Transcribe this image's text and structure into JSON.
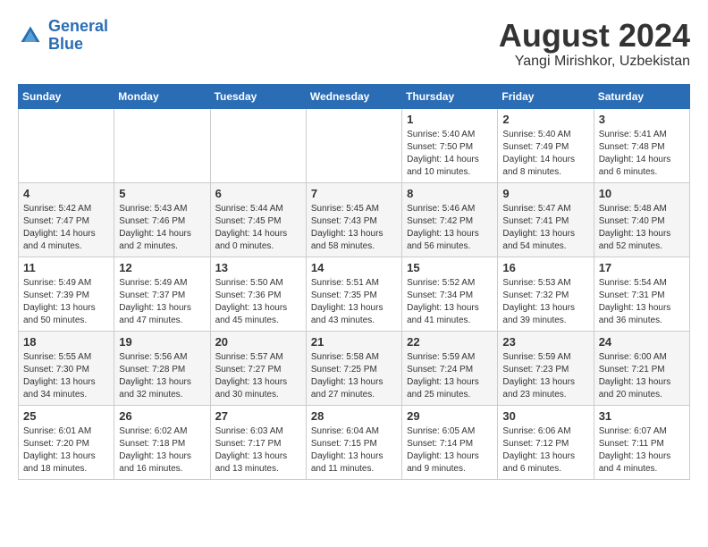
{
  "header": {
    "logo_line1": "General",
    "logo_line2": "Blue",
    "month_year": "August 2024",
    "location": "Yangi Mirishkor, Uzbekistan"
  },
  "days_of_week": [
    "Sunday",
    "Monday",
    "Tuesday",
    "Wednesday",
    "Thursday",
    "Friday",
    "Saturday"
  ],
  "weeks": [
    [
      {
        "num": "",
        "info": ""
      },
      {
        "num": "",
        "info": ""
      },
      {
        "num": "",
        "info": ""
      },
      {
        "num": "",
        "info": ""
      },
      {
        "num": "1",
        "info": "Sunrise: 5:40 AM\nSunset: 7:50 PM\nDaylight: 14 hours\nand 10 minutes."
      },
      {
        "num": "2",
        "info": "Sunrise: 5:40 AM\nSunset: 7:49 PM\nDaylight: 14 hours\nand 8 minutes."
      },
      {
        "num": "3",
        "info": "Sunrise: 5:41 AM\nSunset: 7:48 PM\nDaylight: 14 hours\nand 6 minutes."
      }
    ],
    [
      {
        "num": "4",
        "info": "Sunrise: 5:42 AM\nSunset: 7:47 PM\nDaylight: 14 hours\nand 4 minutes."
      },
      {
        "num": "5",
        "info": "Sunrise: 5:43 AM\nSunset: 7:46 PM\nDaylight: 14 hours\nand 2 minutes."
      },
      {
        "num": "6",
        "info": "Sunrise: 5:44 AM\nSunset: 7:45 PM\nDaylight: 14 hours\nand 0 minutes."
      },
      {
        "num": "7",
        "info": "Sunrise: 5:45 AM\nSunset: 7:43 PM\nDaylight: 13 hours\nand 58 minutes."
      },
      {
        "num": "8",
        "info": "Sunrise: 5:46 AM\nSunset: 7:42 PM\nDaylight: 13 hours\nand 56 minutes."
      },
      {
        "num": "9",
        "info": "Sunrise: 5:47 AM\nSunset: 7:41 PM\nDaylight: 13 hours\nand 54 minutes."
      },
      {
        "num": "10",
        "info": "Sunrise: 5:48 AM\nSunset: 7:40 PM\nDaylight: 13 hours\nand 52 minutes."
      }
    ],
    [
      {
        "num": "11",
        "info": "Sunrise: 5:49 AM\nSunset: 7:39 PM\nDaylight: 13 hours\nand 50 minutes."
      },
      {
        "num": "12",
        "info": "Sunrise: 5:49 AM\nSunset: 7:37 PM\nDaylight: 13 hours\nand 47 minutes."
      },
      {
        "num": "13",
        "info": "Sunrise: 5:50 AM\nSunset: 7:36 PM\nDaylight: 13 hours\nand 45 minutes."
      },
      {
        "num": "14",
        "info": "Sunrise: 5:51 AM\nSunset: 7:35 PM\nDaylight: 13 hours\nand 43 minutes."
      },
      {
        "num": "15",
        "info": "Sunrise: 5:52 AM\nSunset: 7:34 PM\nDaylight: 13 hours\nand 41 minutes."
      },
      {
        "num": "16",
        "info": "Sunrise: 5:53 AM\nSunset: 7:32 PM\nDaylight: 13 hours\nand 39 minutes."
      },
      {
        "num": "17",
        "info": "Sunrise: 5:54 AM\nSunset: 7:31 PM\nDaylight: 13 hours\nand 36 minutes."
      }
    ],
    [
      {
        "num": "18",
        "info": "Sunrise: 5:55 AM\nSunset: 7:30 PM\nDaylight: 13 hours\nand 34 minutes."
      },
      {
        "num": "19",
        "info": "Sunrise: 5:56 AM\nSunset: 7:28 PM\nDaylight: 13 hours\nand 32 minutes."
      },
      {
        "num": "20",
        "info": "Sunrise: 5:57 AM\nSunset: 7:27 PM\nDaylight: 13 hours\nand 30 minutes."
      },
      {
        "num": "21",
        "info": "Sunrise: 5:58 AM\nSunset: 7:25 PM\nDaylight: 13 hours\nand 27 minutes."
      },
      {
        "num": "22",
        "info": "Sunrise: 5:59 AM\nSunset: 7:24 PM\nDaylight: 13 hours\nand 25 minutes."
      },
      {
        "num": "23",
        "info": "Sunrise: 5:59 AM\nSunset: 7:23 PM\nDaylight: 13 hours\nand 23 minutes."
      },
      {
        "num": "24",
        "info": "Sunrise: 6:00 AM\nSunset: 7:21 PM\nDaylight: 13 hours\nand 20 minutes."
      }
    ],
    [
      {
        "num": "25",
        "info": "Sunrise: 6:01 AM\nSunset: 7:20 PM\nDaylight: 13 hours\nand 18 minutes."
      },
      {
        "num": "26",
        "info": "Sunrise: 6:02 AM\nSunset: 7:18 PM\nDaylight: 13 hours\nand 16 minutes."
      },
      {
        "num": "27",
        "info": "Sunrise: 6:03 AM\nSunset: 7:17 PM\nDaylight: 13 hours\nand 13 minutes."
      },
      {
        "num": "28",
        "info": "Sunrise: 6:04 AM\nSunset: 7:15 PM\nDaylight: 13 hours\nand 11 minutes."
      },
      {
        "num": "29",
        "info": "Sunrise: 6:05 AM\nSunset: 7:14 PM\nDaylight: 13 hours\nand 9 minutes."
      },
      {
        "num": "30",
        "info": "Sunrise: 6:06 AM\nSunset: 7:12 PM\nDaylight: 13 hours\nand 6 minutes."
      },
      {
        "num": "31",
        "info": "Sunrise: 6:07 AM\nSunset: 7:11 PM\nDaylight: 13 hours\nand 4 minutes."
      }
    ]
  ]
}
